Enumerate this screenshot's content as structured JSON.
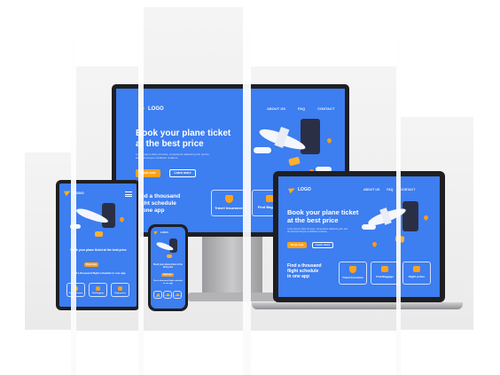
{
  "brand": {
    "logo_text": "LOGO"
  },
  "nav": {
    "about": "ABOUT US",
    "faq": "FAQ",
    "contact": "CONTACT"
  },
  "hero": {
    "headline_line1": "Book your plane ticket",
    "headline_line2": "at the best price",
    "tablet_headline": "Book your plane ticket at the best price",
    "subtext": "Lorem ipsum dolor sit amet, consectetur adipiscing elit, sed do eiusmod tempor incididunt ut labore."
  },
  "buttons": {
    "book": "Book now",
    "learn": "Learn more"
  },
  "features": {
    "find_line1": "Find a thousand",
    "find_line2": "flight schedule",
    "find_line3": "in one app",
    "find_full": "Find a thousand flight schedule in one app",
    "cards": [
      "Travel Insurance",
      "Find Baggage",
      "Flight promo"
    ]
  },
  "colors": {
    "screen_bg": "#3d7ef0",
    "accent": "#ffa21a",
    "bezel": "#1f1f22"
  }
}
